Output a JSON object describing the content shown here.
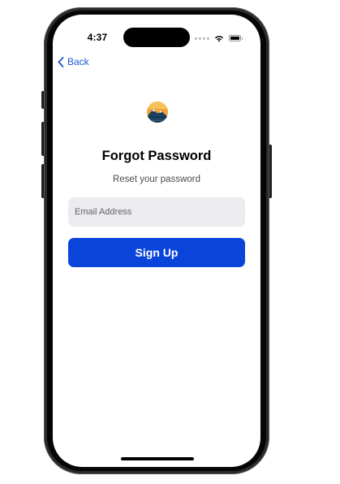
{
  "status_bar": {
    "time": "4:37",
    "signal_icon": "signal-dots-icon",
    "wifi_icon": "wifi-icon",
    "battery_icon": "battery-icon"
  },
  "nav": {
    "back_label": "Back",
    "back_icon": "chevron-left-icon"
  },
  "logo": {
    "icon": "mountain-sunset-logo"
  },
  "header": {
    "title": "Forgot Password",
    "subtitle": "Reset your password"
  },
  "form": {
    "email_placeholder": "Email Address",
    "email_value": "",
    "submit_label": "Sign Up"
  },
  "colors": {
    "accent": "#0a44db",
    "link": "#1a5bd1",
    "input_bg": "#ebebf0"
  }
}
